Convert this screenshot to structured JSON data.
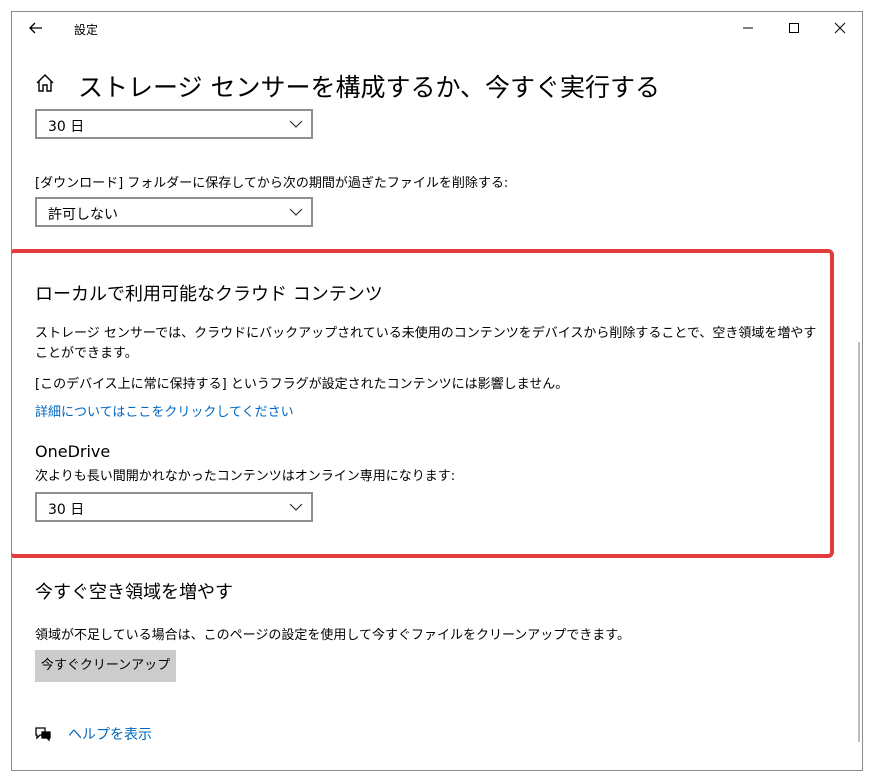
{
  "window": {
    "title": "設定"
  },
  "page": {
    "title": "ストレージ センサーを構成するか、今すぐ実行する"
  },
  "recycle_dropdown": {
    "value": "30 日"
  },
  "downloads": {
    "label": "[ダウンロード] フォルダーに保存してから次の期間が過ぎたファイルを削除する:",
    "value": "許可しない"
  },
  "cloud": {
    "heading": "ローカルで利用可能なクラウド コンテンツ",
    "description": "ストレージ センサーでは、クラウドにバックアップされている未使用のコンテンツをデバイスから削除することで、空き領域を増やすことができます。",
    "note": "[このデバイス上に常に保持する] というフラグが設定されたコンテンツには影響しません。",
    "link": "詳細についてはここをクリックしてください",
    "onedrive_heading": "OneDrive",
    "onedrive_label": "次よりも長い間開かれなかったコンテンツはオンライン専用になります:",
    "onedrive_value": "30 日"
  },
  "free_now": {
    "heading": "今すぐ空き領域を増やす",
    "description": "領域が不足している場合は、このページの設定を使用して今すぐファイルをクリーンアップできます。",
    "button": "今すぐクリーンアップ"
  },
  "help": {
    "link": "ヘルプを表示"
  },
  "colors": {
    "link": "#0067c0",
    "highlight": "#e13b3b",
    "button": "#cccccc"
  }
}
